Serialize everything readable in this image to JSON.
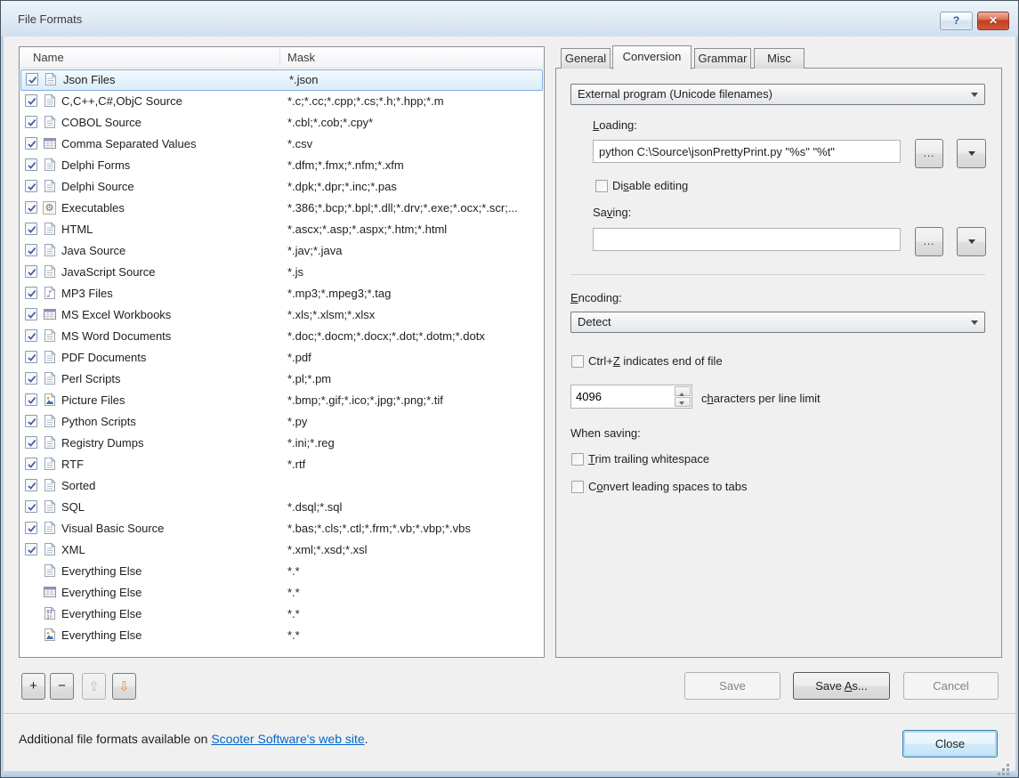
{
  "window": {
    "title": "File Formats",
    "help_glyph": "?",
    "close_glyph": "✕"
  },
  "colors": {
    "dialog_bg": "#F0F0F0",
    "titlebar": "#D8E4F0",
    "close_button_red": "#C33D23",
    "selection_border": "#84ACDD",
    "selection_fill": "#D9EDFB",
    "link_blue": "#0066CC",
    "default_button_border": "#3C7FB1",
    "down_arrow_gold": "#D89A2B"
  },
  "list": {
    "columns": [
      "Name",
      "Mask"
    ],
    "rows": [
      {
        "name": "Json Files",
        "mask": "*.json",
        "icon": "doc",
        "has_checkbox": true,
        "checked": true,
        "selected": true
      },
      {
        "name": "C,C++,C#,ObjC Source",
        "mask": "*.c;*.cc;*.cpp;*.cs;*.h;*.hpp;*.m",
        "icon": "doc",
        "has_checkbox": true,
        "checked": true,
        "selected": false
      },
      {
        "name": "COBOL Source",
        "mask": "*.cbl;*.cob;*.cpy*",
        "icon": "doc",
        "has_checkbox": true,
        "checked": true,
        "selected": false
      },
      {
        "name": "Comma Separated Values",
        "mask": "*.csv",
        "icon": "table",
        "has_checkbox": true,
        "checked": true,
        "selected": false
      },
      {
        "name": "Delphi Forms",
        "mask": "*.dfm;*.fmx;*.nfm;*.xfm",
        "icon": "doc",
        "has_checkbox": true,
        "checked": true,
        "selected": false
      },
      {
        "name": "Delphi Source",
        "mask": "*.dpk;*.dpr;*.inc;*.pas",
        "icon": "doc",
        "has_checkbox": true,
        "checked": true,
        "selected": false
      },
      {
        "name": "Executables",
        "mask": "*.386;*.bcp;*.bpl;*.dll;*.drv;*.exe;*.ocx;*.scr;...",
        "icon": "gear",
        "has_checkbox": true,
        "checked": true,
        "selected": false
      },
      {
        "name": "HTML",
        "mask": "*.ascx;*.asp;*.aspx;*.htm;*.html",
        "icon": "doc",
        "has_checkbox": true,
        "checked": true,
        "selected": false
      },
      {
        "name": "Java Source",
        "mask": "*.jav;*.java",
        "icon": "doc",
        "has_checkbox": true,
        "checked": true,
        "selected": false
      },
      {
        "name": "JavaScript Source",
        "mask": "*.js",
        "icon": "doc",
        "has_checkbox": true,
        "checked": true,
        "selected": false
      },
      {
        "name": "MP3 Files",
        "mask": "*.mp3;*.mpeg3;*.tag",
        "icon": "music",
        "has_checkbox": true,
        "checked": true,
        "selected": false
      },
      {
        "name": "MS Excel Workbooks",
        "mask": "*.xls;*.xlsm;*.xlsx",
        "icon": "table",
        "has_checkbox": true,
        "checked": true,
        "selected": false
      },
      {
        "name": "MS Word Documents",
        "mask": "*.doc;*.docm;*.docx;*.dot;*.dotm;*.dotx",
        "icon": "doc",
        "has_checkbox": true,
        "checked": true,
        "selected": false
      },
      {
        "name": "PDF Documents",
        "mask": "*.pdf",
        "icon": "doc",
        "has_checkbox": true,
        "checked": true,
        "selected": false
      },
      {
        "name": "Perl Scripts",
        "mask": "*.pl;*.pm",
        "icon": "doc",
        "has_checkbox": true,
        "checked": true,
        "selected": false
      },
      {
        "name": "Picture Files",
        "mask": "*.bmp;*.gif;*.ico;*.jpg;*.png;*.tif",
        "icon": "image",
        "has_checkbox": true,
        "checked": true,
        "selected": false
      },
      {
        "name": "Python Scripts",
        "mask": "*.py",
        "icon": "doc",
        "has_checkbox": true,
        "checked": true,
        "selected": false
      },
      {
        "name": "Registry Dumps",
        "mask": "*.ini;*.reg",
        "icon": "doc",
        "has_checkbox": true,
        "checked": true,
        "selected": false
      },
      {
        "name": "RTF",
        "mask": "*.rtf",
        "icon": "doc",
        "has_checkbox": true,
        "checked": true,
        "selected": false
      },
      {
        "name": "Sorted",
        "mask": "",
        "icon": "doc",
        "has_checkbox": true,
        "checked": true,
        "selected": false
      },
      {
        "name": "SQL",
        "mask": "*.dsql;*.sql",
        "icon": "doc",
        "has_checkbox": true,
        "checked": true,
        "selected": false
      },
      {
        "name": "Visual Basic Source",
        "mask": "*.bas;*.cls;*.ctl;*.frm;*.vb;*.vbp;*.vbs",
        "icon": "doc",
        "has_checkbox": true,
        "checked": true,
        "selected": false
      },
      {
        "name": "XML",
        "mask": "*.xml;*.xsd;*.xsl",
        "icon": "doc",
        "has_checkbox": true,
        "checked": true,
        "selected": false
      },
      {
        "name": "Everything Else",
        "mask": "*.*",
        "icon": "doc",
        "has_checkbox": false,
        "checked": false,
        "selected": false
      },
      {
        "name": "Everything Else",
        "mask": "*.*",
        "icon": "table",
        "has_checkbox": false,
        "checked": false,
        "selected": false
      },
      {
        "name": "Everything Else",
        "mask": "*.*",
        "icon": "binary",
        "has_checkbox": false,
        "checked": false,
        "selected": false
      },
      {
        "name": "Everything Else",
        "mask": "*.*",
        "icon": "image",
        "has_checkbox": false,
        "checked": false,
        "selected": false
      }
    ]
  },
  "toolbar": {
    "add_glyph": "+",
    "remove_glyph": "−",
    "up_glyph": "⇧",
    "down_glyph": "⇩"
  },
  "tabs": {
    "active_index": 1,
    "items": [
      {
        "label": "General"
      },
      {
        "label": "Conversion"
      },
      {
        "label": "Grammar"
      },
      {
        "label": "Misc"
      }
    ]
  },
  "conversion": {
    "program_select_value": "External program (Unicode filenames)",
    "loading_label": {
      "text": "Loading:",
      "ak": 0
    },
    "loading_value": "python C:\\Source\\jsonPrettyPrint.py \"%s\" \"%t\"",
    "browse_glyph": "...",
    "disable_editing_label": {
      "text": "Disable editing",
      "ak": 2
    },
    "saving_label": {
      "text": "Saving:",
      "ak": 2
    },
    "saving_value": "",
    "encoding_label": {
      "text": "Encoding:",
      "ak": 0
    },
    "encoding_value": "Detect",
    "ctrlz_label": {
      "text": "Ctrl+Z indicates end of file",
      "ak": 5
    },
    "char_limit_value": "4096",
    "char_limit_label": {
      "text": "characters per line limit",
      "ak": 1
    },
    "when_saving_label": "When saving:",
    "trim_label": {
      "text": "Trim trailing whitespace",
      "ak": 0
    },
    "convert_label": {
      "text": "Convert leading spaces to tabs",
      "ak": 1
    }
  },
  "buttons": {
    "save": "Save",
    "save_as": {
      "text": "Save As...",
      "ak": 5
    },
    "cancel": "Cancel",
    "close": "Close"
  },
  "footer": {
    "text_before": "Additional file formats available on ",
    "link_text": "Scooter Software's web site",
    "text_after": "."
  }
}
